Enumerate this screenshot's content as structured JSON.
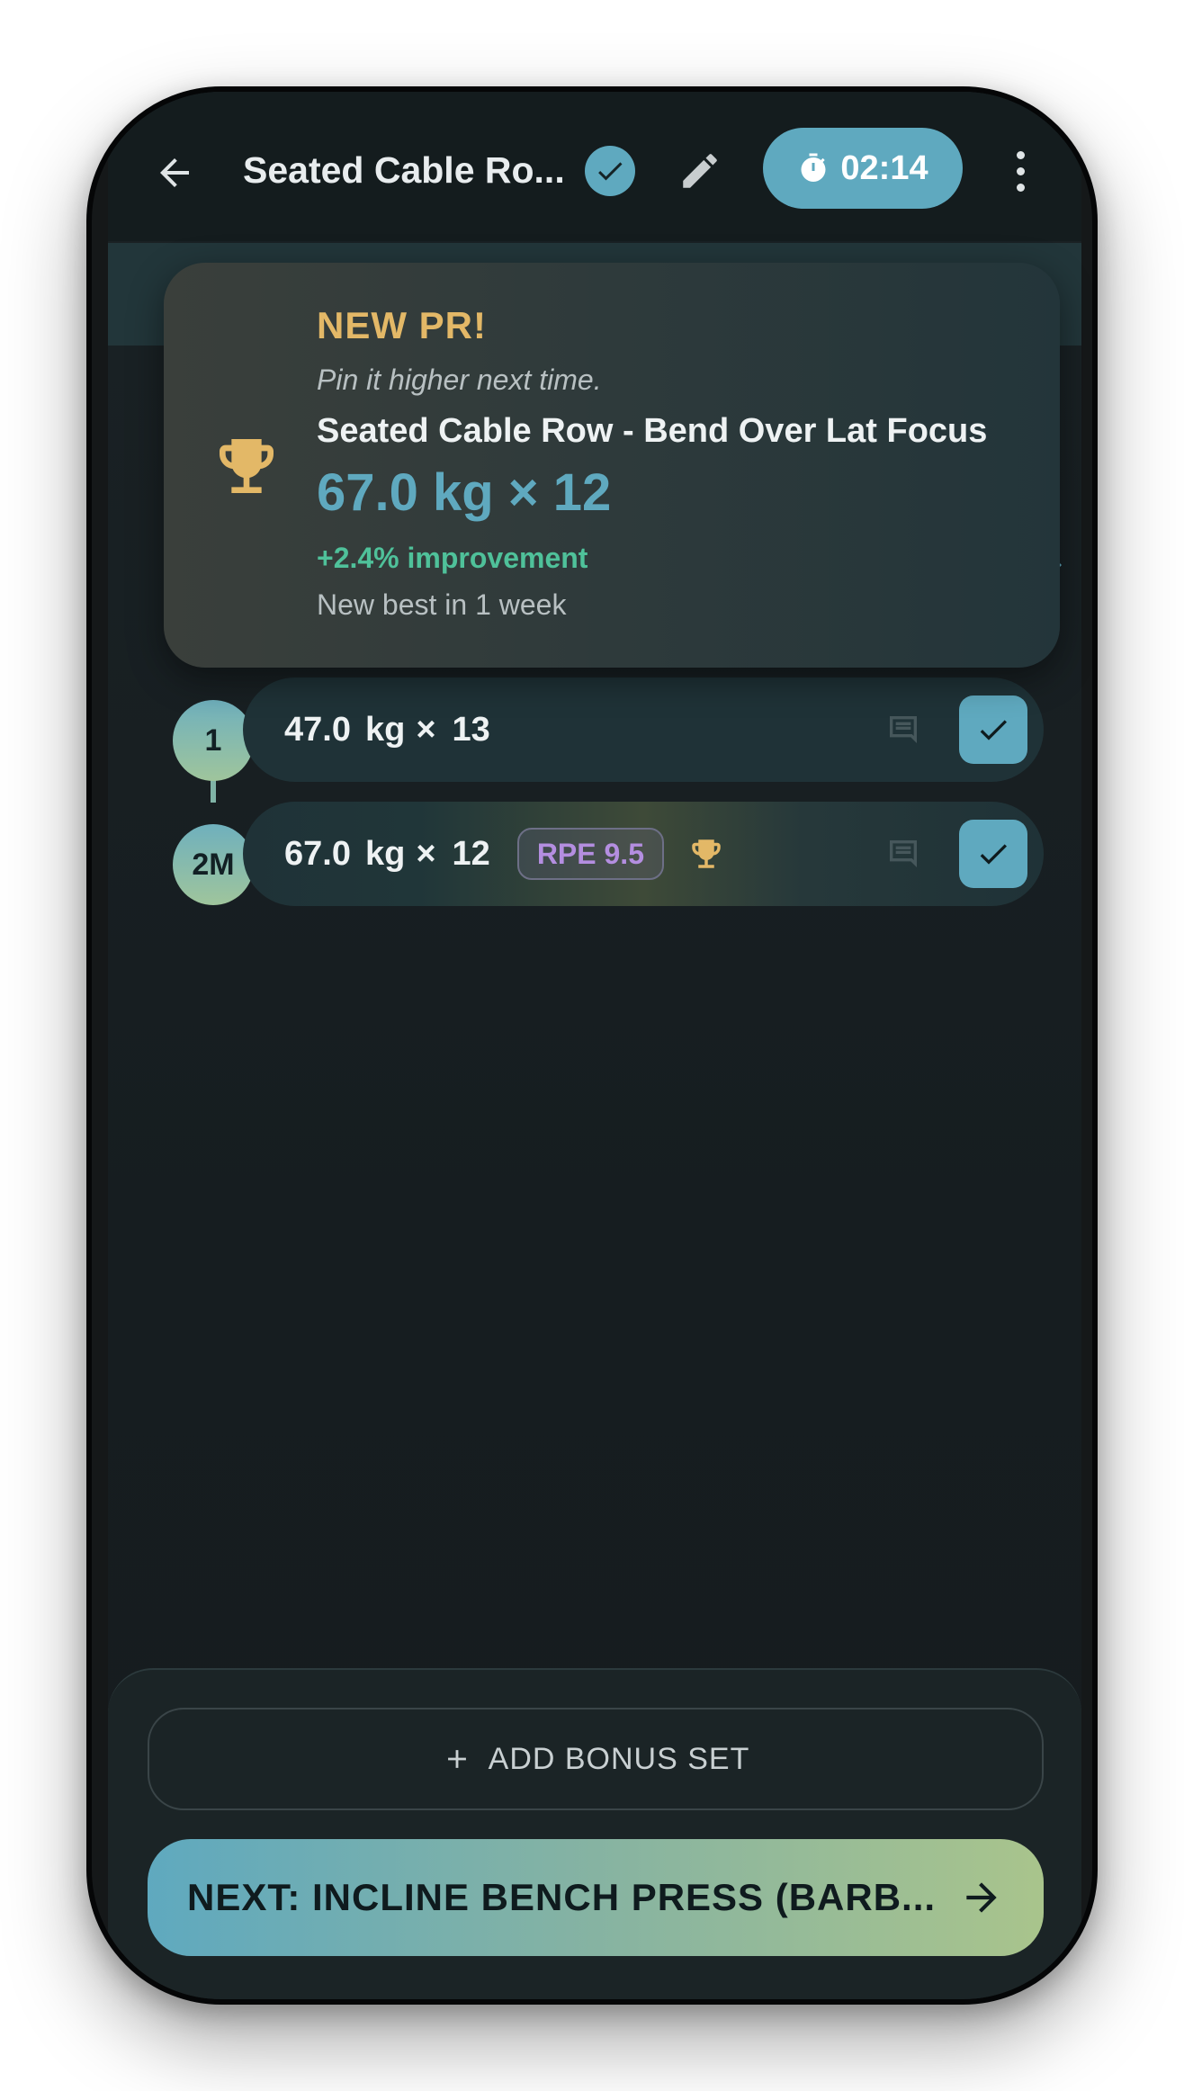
{
  "app_bar": {
    "title": "Seated Cable Ro...",
    "timer": "02:14"
  },
  "pr_toast": {
    "heading": "NEW PR!",
    "tagline": "Pin it higher next time.",
    "exercise": "Seated Cable Row - Bend Over Lat Focus",
    "value": "67.0 kg × 12",
    "improvement": "+2.4% improvement",
    "since": "New best in 1 week"
  },
  "sets": [
    {
      "number": "1",
      "weight": "47.0",
      "unit": "kg",
      "times": "×",
      "reps": "13",
      "completed": true
    },
    {
      "number": "2M",
      "weight": "67.0",
      "unit": "kg",
      "times": "×",
      "reps": "12",
      "rpe": "RPE 9.5",
      "is_pr": true,
      "completed": true
    }
  ],
  "bottom": {
    "add_bonus_label": "ADD BONUS SET",
    "next_label": "NEXT: INCLINE BENCH PRESS (BARB..."
  },
  "colors": {
    "accent": "#5fa9bf",
    "pr_gold": "#e3b867",
    "improvement_green": "#4fc19a",
    "rpe_purple": "#b48ee0"
  },
  "icons": {
    "back": "arrow-left-icon",
    "verified": "check-circle-icon",
    "edit": "pencil-icon",
    "timer": "stopwatch-icon",
    "more": "more-vertical-icon",
    "trophy": "trophy-icon",
    "note": "comment-icon",
    "done": "check-icon",
    "add": "plus-icon",
    "next": "arrow-right-icon"
  }
}
